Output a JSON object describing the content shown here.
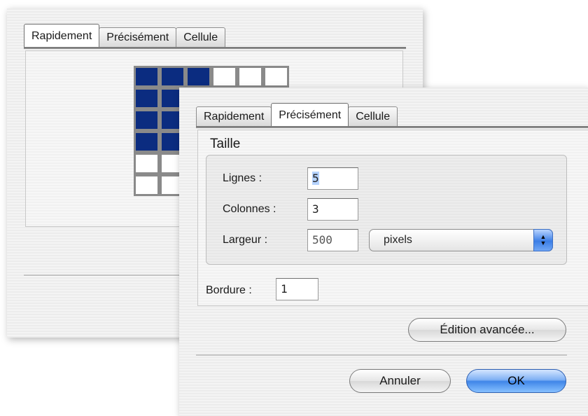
{
  "back_dialog": {
    "tabs": [
      "Rapidement",
      "Précisément",
      "Cellule"
    ],
    "active_tab": "Rapidement",
    "grid": {
      "rows": 6,
      "cols": 6,
      "filled": [
        [
          true,
          true,
          true,
          false,
          false,
          false
        ],
        [
          true,
          true,
          true,
          false,
          false,
          false
        ],
        [
          true,
          true,
          true,
          false,
          false,
          false
        ],
        [
          true,
          true,
          true,
          false,
          false,
          false
        ],
        [
          false,
          false,
          false,
          false,
          false,
          false
        ],
        [
          false,
          false,
          false,
          false,
          false,
          false
        ]
      ],
      "fill_color": "#0b2c80"
    }
  },
  "front_dialog": {
    "tabs": [
      "Rapidement",
      "Précisément",
      "Cellule"
    ],
    "active_tab": "Précisément",
    "size_group": {
      "label": "Taille",
      "rows_label": "Lignes :",
      "rows_value": "5",
      "cols_label": "Colonnes :",
      "cols_value": "3",
      "width_label": "Largeur :",
      "width_value": "500",
      "unit_value": "pixels"
    },
    "border_label": "Bordure :",
    "border_value": "1",
    "advanced_button": "Édition avancée...",
    "cancel_button": "Annuler",
    "ok_button": "OK",
    "accent_color": "#3f86e8"
  }
}
